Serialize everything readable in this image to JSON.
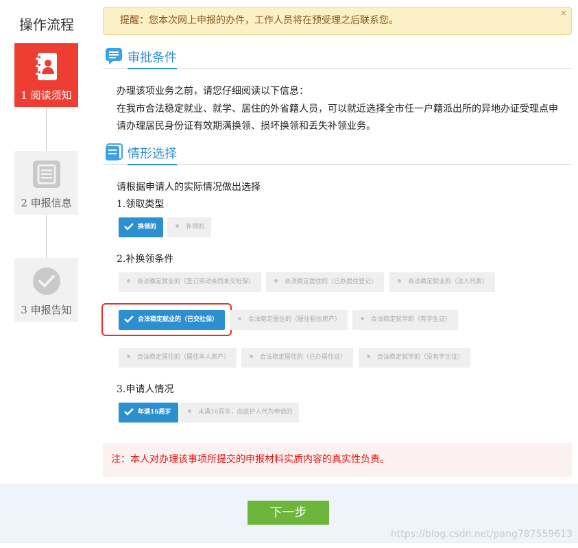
{
  "sidebar": {
    "title": "操作流程",
    "steps": [
      {
        "label": "1 阅读须知",
        "icon": "contact-book-icon"
      },
      {
        "label": "2 申报信息",
        "icon": "document-list-icon"
      },
      {
        "label": "3 申报告知",
        "icon": "check-circle-icon"
      }
    ]
  },
  "alert": {
    "text": "提醒：您本次网上申报的办件，工作人员将在预受理之后联系您。",
    "close": "×"
  },
  "approval": {
    "title": "审批条件",
    "lines": [
      "办理该项业务之前，请您仔细阅读以下信息：",
      "在我市合法稳定就业、就学、居住的外省籍人员，可以就近选择全市任一户籍派出所的异地办证受理点申",
      "请办理居民身份证有效期满换领、损坏换领和丢失补领业务。"
    ]
  },
  "situation": {
    "title": "情形选择",
    "intro": "请根据申请人的实际情况做出选择",
    "groups": [
      {
        "title": "1.领取类型",
        "options": [
          {
            "label": "换领的",
            "selected": true
          },
          {
            "label": "补领的",
            "selected": false
          }
        ]
      },
      {
        "title": "2.补换领条件",
        "options": [
          {
            "label": "合法稳定就业的（签订劳动合同未交社保）",
            "selected": false
          },
          {
            "label": "合法稳定居住的（已办居住登记）",
            "selected": false
          },
          {
            "label": "合法稳定就业的（法人代表）",
            "selected": false
          },
          {
            "label": "合法稳定就业的（已交社保）",
            "selected": true
          },
          {
            "label": "合法稳定居住的（居住租住房产）",
            "selected": false
          },
          {
            "label": "合法稳定就学的（有学生证）",
            "selected": false
          },
          {
            "label": "合法稳定居住的（居住本人房产）",
            "selected": false
          },
          {
            "label": "合法稳定居住的（已办居住证）",
            "selected": false
          },
          {
            "label": "合法稳定就学的（没有学生证）",
            "selected": false
          }
        ]
      },
      {
        "title": "3.申请人情况",
        "options": [
          {
            "label": "年满16周岁",
            "selected": true
          },
          {
            "label": "未满16周岁，由监护人代为申请的",
            "selected": false
          }
        ]
      }
    ]
  },
  "notice": "注：本人对办理该事项所提交的申报材料实质内容的真实性负责。",
  "next_button": "下一步",
  "watermark": "https://blog.csdn.net/pang787559613",
  "colors": {
    "accent": "#2c8fd0",
    "active_step": "#ee3d33",
    "next_button": "#6db63b",
    "notice_text": "#e01818"
  }
}
